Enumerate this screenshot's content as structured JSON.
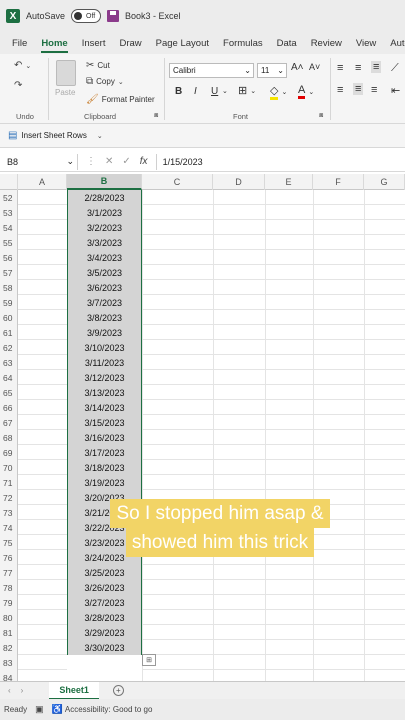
{
  "titlebar": {
    "app_logo": "X",
    "autosave_label": "AutoSave",
    "autosave_state": "Off",
    "title": "Book3 - Excel"
  },
  "tabs": [
    "File",
    "Home",
    "Insert",
    "Draw",
    "Page Layout",
    "Formulas",
    "Data",
    "Review",
    "View",
    "Automate"
  ],
  "active_tab": "Home",
  "ribbon": {
    "undo_label": "Undo",
    "paste_label": "Paste",
    "cut_label": "Cut",
    "copy_label": "Copy",
    "format_painter_label": "Format Painter",
    "clipboard_label": "Clipboard",
    "font_name": "Calibri",
    "font_size": "11",
    "bold": "B",
    "italic": "I",
    "underline": "U",
    "font_label": "Font"
  },
  "quick_bar": {
    "insert_rows_label": "Insert Sheet Rows"
  },
  "formula_bar": {
    "name_box": "B8",
    "fx": "fx",
    "value": "1/15/2023"
  },
  "columns": [
    "A",
    "B",
    "C",
    "D",
    "E",
    "F",
    "G"
  ],
  "rows": [
    {
      "num": "52",
      "b": "2/28/2023"
    },
    {
      "num": "53",
      "b": "3/1/2023"
    },
    {
      "num": "54",
      "b": "3/2/2023"
    },
    {
      "num": "55",
      "b": "3/3/2023"
    },
    {
      "num": "56",
      "b": "3/4/2023"
    },
    {
      "num": "57",
      "b": "3/5/2023"
    },
    {
      "num": "58",
      "b": "3/6/2023"
    },
    {
      "num": "59",
      "b": "3/7/2023"
    },
    {
      "num": "60",
      "b": "3/8/2023"
    },
    {
      "num": "61",
      "b": "3/9/2023"
    },
    {
      "num": "62",
      "b": "3/10/2023"
    },
    {
      "num": "63",
      "b": "3/11/2023"
    },
    {
      "num": "64",
      "b": "3/12/2023"
    },
    {
      "num": "65",
      "b": "3/13/2023"
    },
    {
      "num": "66",
      "b": "3/14/2023"
    },
    {
      "num": "67",
      "b": "3/15/2023"
    },
    {
      "num": "68",
      "b": "3/16/2023"
    },
    {
      "num": "69",
      "b": "3/17/2023"
    },
    {
      "num": "70",
      "b": "3/18/2023"
    },
    {
      "num": "71",
      "b": "3/19/2023"
    },
    {
      "num": "72",
      "b": "3/20/2023"
    },
    {
      "num": "73",
      "b": "3/21/2023"
    },
    {
      "num": "74",
      "b": "3/22/2023"
    },
    {
      "num": "75",
      "b": "3/23/2023"
    },
    {
      "num": "76",
      "b": "3/24/2023"
    },
    {
      "num": "77",
      "b": "3/25/2023"
    },
    {
      "num": "78",
      "b": "3/26/2023"
    },
    {
      "num": "79",
      "b": "3/27/2023"
    },
    {
      "num": "80",
      "b": "3/28/2023"
    },
    {
      "num": "81",
      "b": "3/29/2023"
    },
    {
      "num": "82",
      "b": "3/30/2023"
    },
    {
      "num": "83",
      "b": ""
    },
    {
      "num": "84",
      "b": ""
    }
  ],
  "sheet_tab": "Sheet1",
  "status": {
    "ready": "Ready",
    "accessibility": "Accessibility: Good to go"
  },
  "caption": {
    "line1": "So I stopped him asap &",
    "line2": "showed him this trick"
  }
}
